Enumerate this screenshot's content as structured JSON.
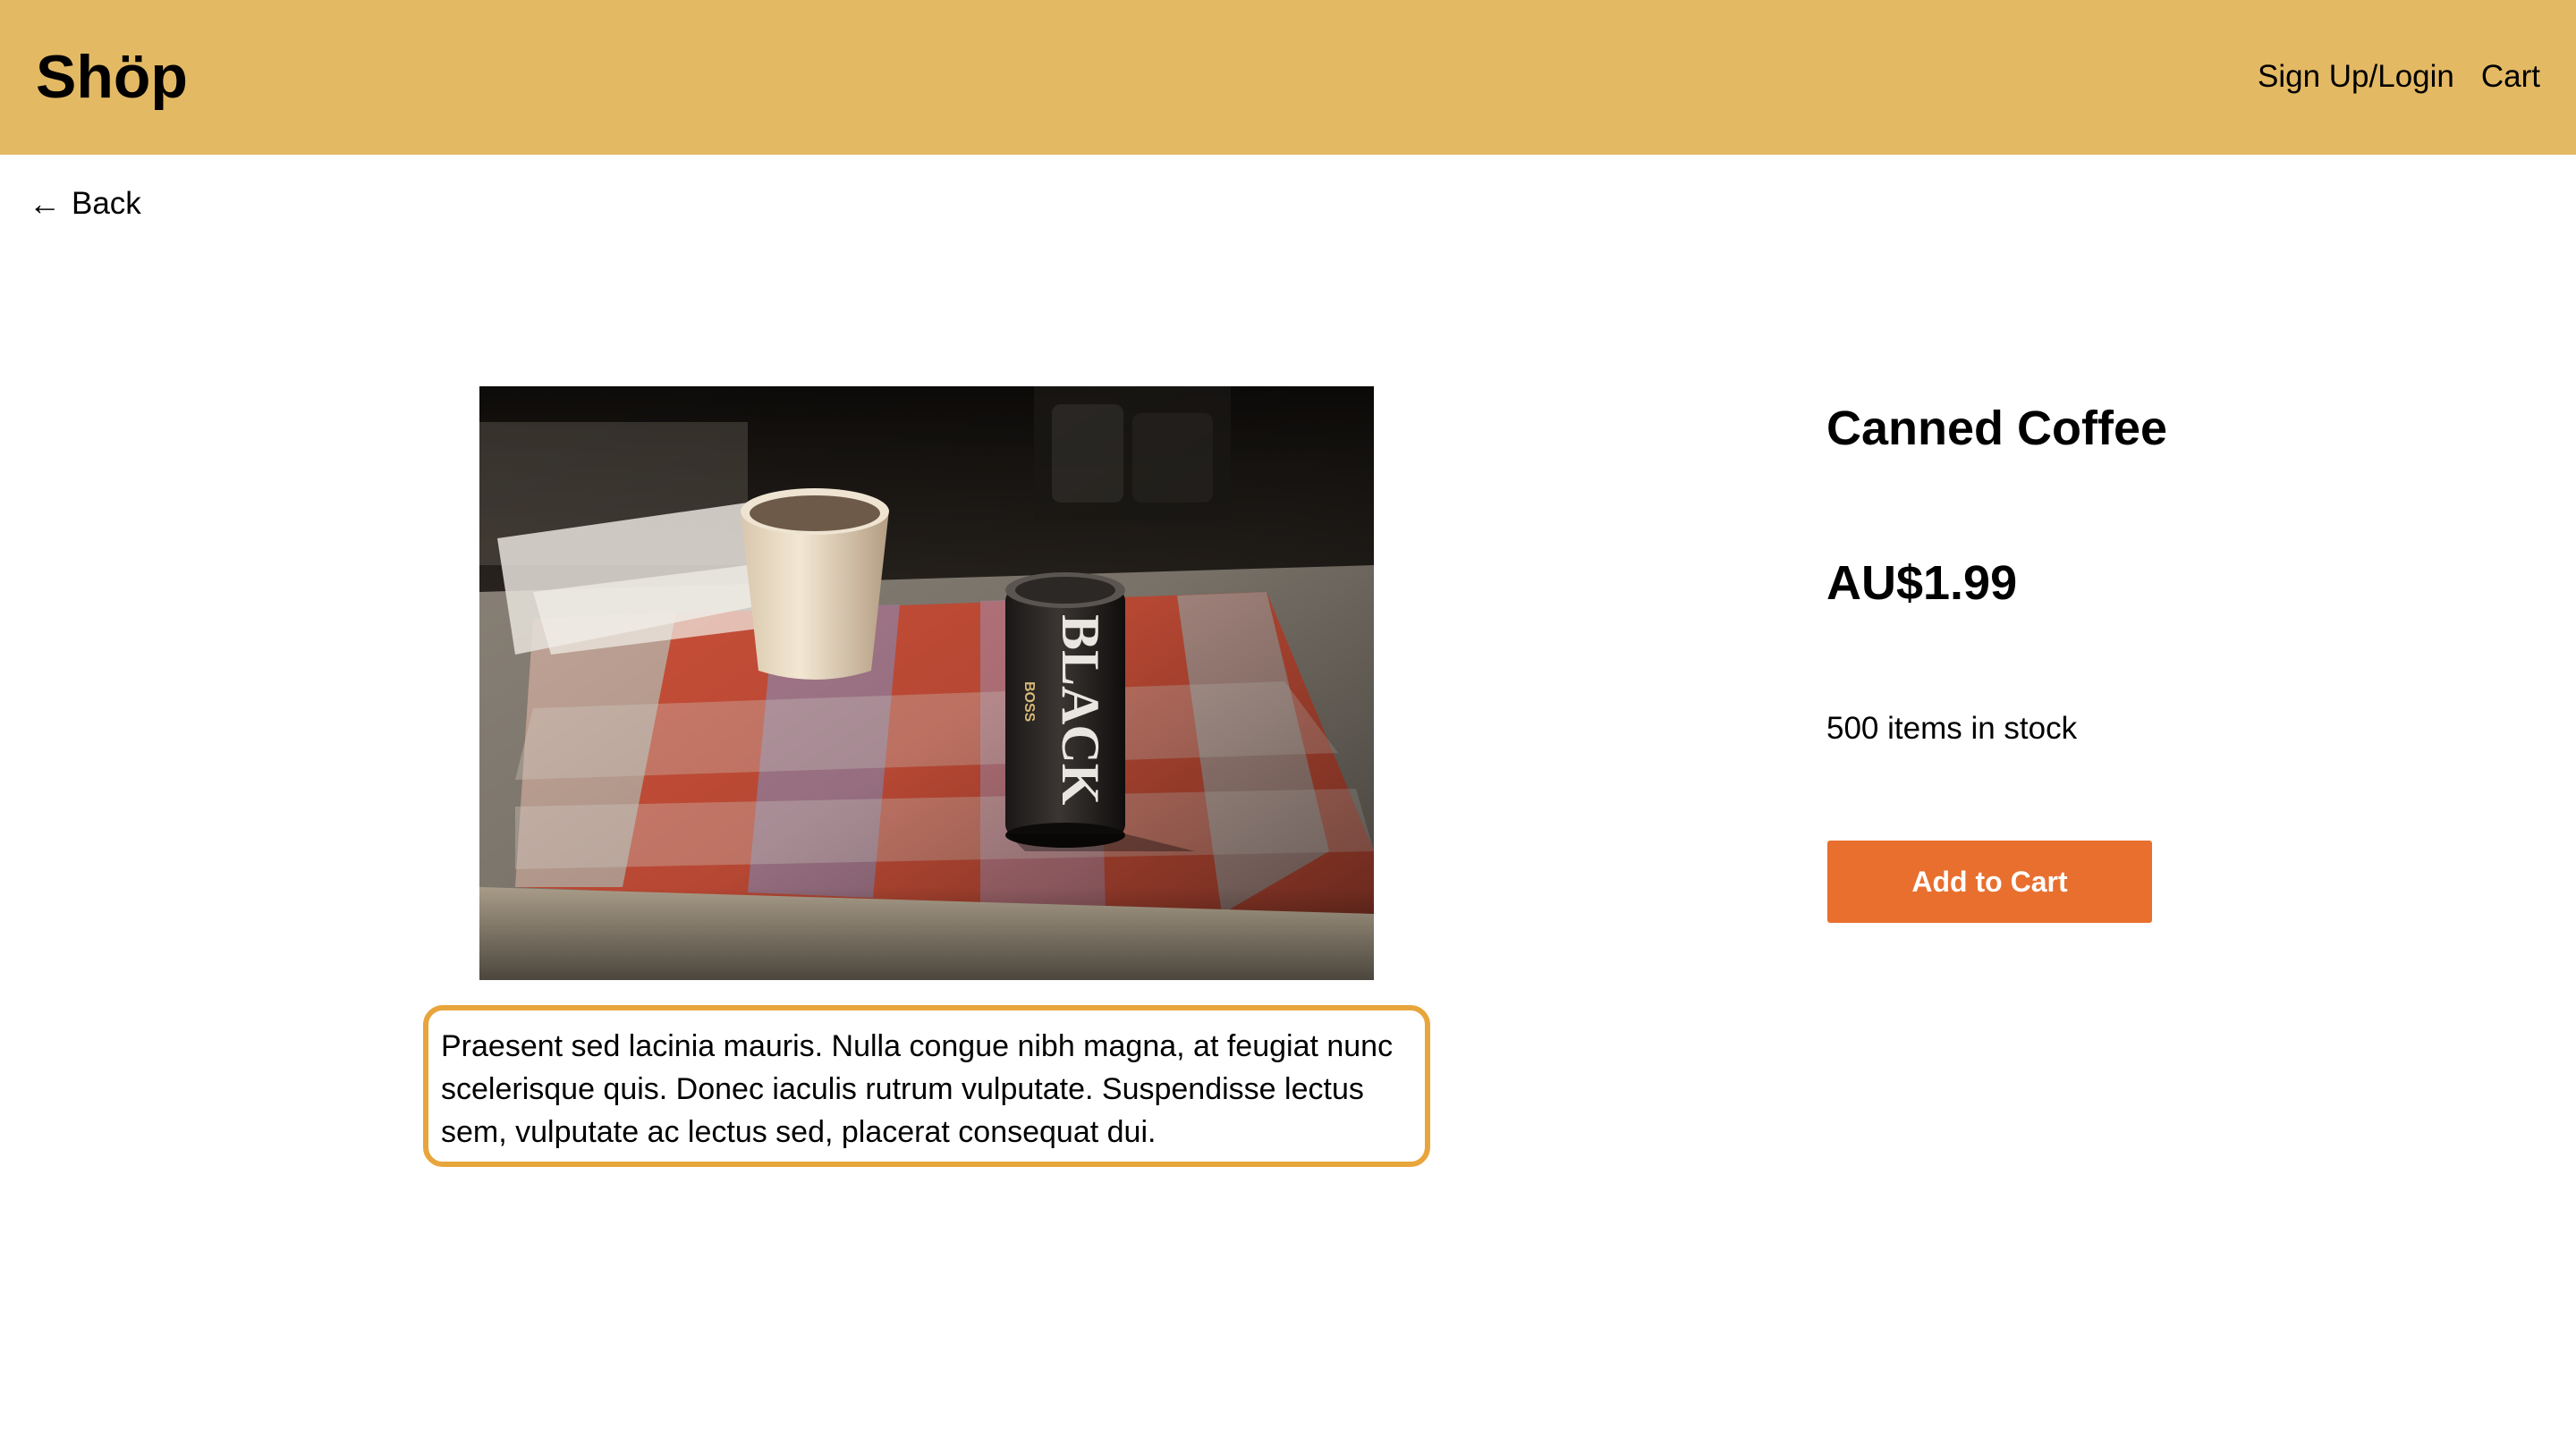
{
  "header": {
    "logo": "Shöp",
    "nav": {
      "signup_login": "Sign Up/Login",
      "cart": "Cart"
    }
  },
  "back": {
    "arrow": "←",
    "label": "Back"
  },
  "product": {
    "image_alt": "Canned Coffee",
    "description": "Praesent sed lacinia mauris. Nulla congue nibh magna, at feugiat nunc scelerisque quis. Donec iaculis rutrum vulputate. Suspendisse lectus sem, vulputate ac lectus sed, placerat consequat dui.",
    "title": "Canned Coffee",
    "price": "AU$1.99",
    "stock": "500 items in stock",
    "add_to_cart_label": "Add to Cart",
    "image_can_text": "BLACK",
    "image_can_brand": "BOSS"
  },
  "colors": {
    "header_bg": "#e3b964",
    "accent_button": "#e86f2e",
    "highlight_border": "#e8a53b"
  }
}
